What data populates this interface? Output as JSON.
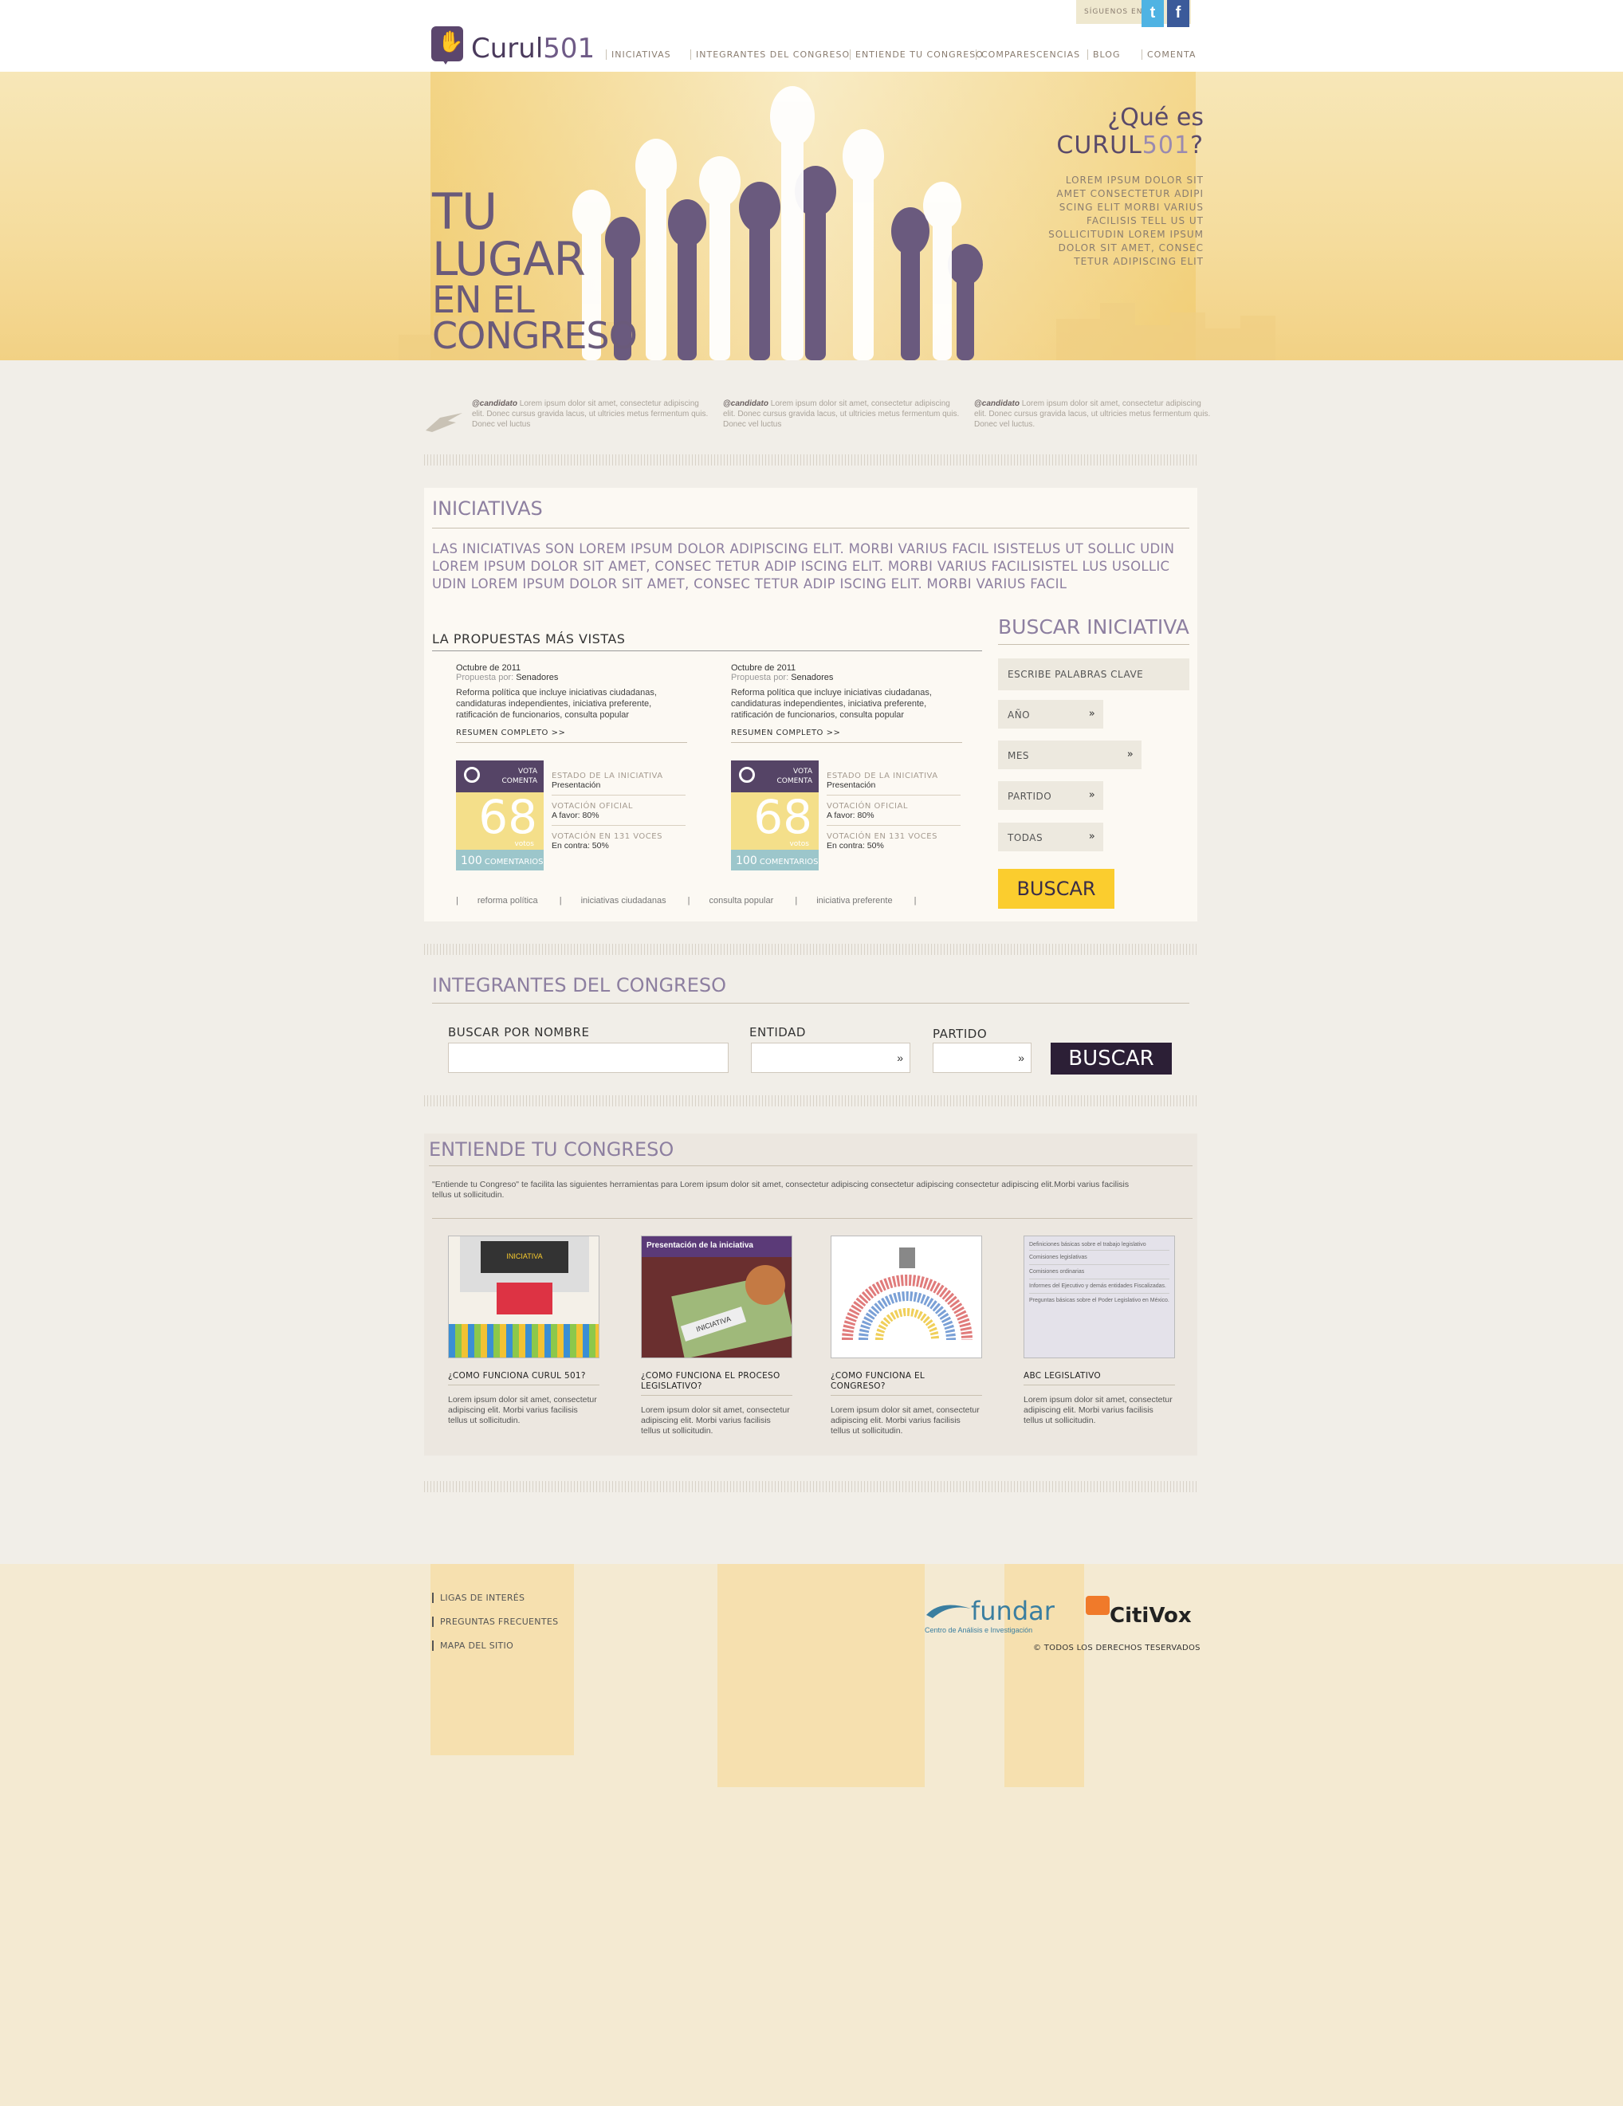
{
  "header": {
    "follow_label": "SÍGUENOS EN",
    "twitter_icon": "twitter-icon",
    "facebook_icon": "facebook-icon",
    "logo_text": "Curul",
    "logo_num": "501",
    "nav": [
      "INICIATIVAS",
      "INTEGRANTES DEL CONGRESO",
      "ENTIENDE TU CONGRESO",
      "COMPARESCENCIAS",
      "BLOG",
      "COMENTA"
    ]
  },
  "hero": {
    "title_lines": [
      "TU",
      "LUGAR",
      "EN EL",
      "CONGRESO"
    ],
    "que_line1": "¿Qué es",
    "que_line2_a": "CURUL",
    "que_line2_b": "501",
    "que_line2_c": "?",
    "description": "LOREM IPSUM DOLOR SIT AMET CONSECTETUR ADIPI SCING ELIT MORBI VARIUS FACILISIS TELL US UT SOLLICITUDIN LOREM IPSUM DOLOR SIT AMET, CONSEC TETUR ADIPISCING ELIT"
  },
  "tweets": [
    {
      "user": "@candidato",
      "text": "Lorem ipsum dolor sit amet, consectetur adipiscing elit. Donec cursus gravida lacus, ut ultricies metus fermentum quis. Donec vel luctus"
    },
    {
      "user": "@candidato",
      "text": "Lorem ipsum dolor sit amet, consectetur adipiscing elit. Donec cursus gravida lacus, ut ultricies metus fermentum quis. Donec vel luctus"
    },
    {
      "user": "@candidato",
      "text": "Lorem ipsum dolor sit amet, consectetur adipiscing elit. Donec cursus gravida lacus, ut ultricies metus fermentum quis. Donec vel luctus."
    }
  ],
  "iniciativas": {
    "title": "INICIATIVAS",
    "intro": "LAS INICIATIVAS SON LOREM IPSUM DOLOR ADIPISCING ELIT. MORBI VARIUS FACIL ISISTELUS UT SOLLIC UDIN LOREM IPSUM DOLOR SIT AMET, CONSEC TETUR ADIP ISCING ELIT. MORBI  VARIUS FACILISISTEL LUS USOLLIC UDIN LOREM IPSUM DOLOR SIT AMET, CONSEC TETUR ADIP ISCING ELIT. MORBI  VARIUS FACIL",
    "subtitle": "LA PROPUESTAS MÁS VISTAS",
    "cards": [
      {
        "date": "Octubre de 2011",
        "by_label": "Propuesta por:",
        "by": "Senadores",
        "body": "Reforma política que incluye iniciativas ciudadanas, candidaturas independientes, iniciativa preferente, ratificación de funcionarios, consulta popular",
        "more": "RESUMEN COMPLETO >>",
        "vote_line1": "VOTA",
        "vote_line2": "COMENTA",
        "votes": "68",
        "votes_label": "votos",
        "comments_num": "100",
        "comments_label": "COMENTARIOS",
        "estado_label": "ESTADO DE LA INICIATIVA",
        "estado": "Presentación",
        "oficial_label": "VOTACIÓN OFICIAL",
        "oficial": "A favor: 80%",
        "voces_label": "VOTACIÓN EN 131 VOCES",
        "voces": "En contra: 50%"
      },
      {
        "date": "Octubre de 2011",
        "by_label": "Propuesta por:",
        "by": "Senadores",
        "body": "Reforma política que incluye iniciativas ciudadanas, candidaturas independientes, iniciativa preferente, ratificación de funcionarios, consulta popular",
        "more": "RESUMEN COMPLETO >>",
        "vote_line1": "VOTA",
        "vote_line2": "COMENTA",
        "votes": "68",
        "votes_label": "votos",
        "comments_num": "100",
        "comments_label": "COMENTARIOS",
        "estado_label": "ESTADO DE LA INICIATIVA",
        "estado": "Presentación",
        "oficial_label": "VOTACIÓN OFICIAL",
        "oficial": "A favor: 80%",
        "voces_label": "VOTACIÓN EN 131 VOCES",
        "voces": "En contra: 50%"
      }
    ],
    "tags": [
      "reforma política",
      "iniciativas ciudadanas",
      "consulta popular",
      "iniciativa preferente"
    ],
    "search": {
      "title": "BUSCAR INICIATIVA",
      "keywords": "ESCRIBE PALABRAS CLAVE",
      "year": "AÑO",
      "month": "MES",
      "party": "PARTIDO",
      "all": "TODAS",
      "button": "BUSCAR"
    }
  },
  "integrantes": {
    "title": "INTEGRANTES DEL CONGRESO",
    "by_name_label": "BUSCAR POR NOMBRE",
    "entity_label": "ENTIDAD",
    "party_label": "PARTIDO",
    "button": "BUSCAR"
  },
  "entiende": {
    "title": "ENTIENDE TU CONGRESO",
    "intro": "\"Entiende tu Congreso\" te facilita las siguientes herramientas para Lorem ipsum dolor sit amet,  consectetur adipiscing  consectetur adipiscing  consectetur adipiscing elit.Morbi varius facilisis tellus ut sollicitudin.",
    "tools": [
      {
        "title": "¿COMO FUNCIONA CURUL 501?",
        "text": "Lorem ipsum dolor sit amet, consectetur adipiscing elit. Morbi varius facilisis tellus ut sollicitudin.",
        "thumb_label": "INICIATIVA"
      },
      {
        "title": "¿COMO FUNCIONA EL PROCESO LEGISLATIVO?",
        "text": "Lorem ipsum dolor sit amet, consectetur adipiscing elit. Morbi varius facilisis tellus ut sollicitudin.",
        "thumb_label": "Presentación de la iniciativa",
        "thumb_label2": "INICIATIVA"
      },
      {
        "title": "¿COMO FUNCIONA EL CONGRESO?",
        "text": "Lorem ipsum dolor sit amet, consectetur adipiscing elit. Morbi varius facilisis tellus ut sollicitudin."
      },
      {
        "title": "ABC LEGISLATIVO",
        "text": "Lorem ipsum dolor sit amet, consectetur adipiscing elit. Morbi varius facilisis tellus ut sollicitudin.",
        "list": [
          "Definiciones básicas sobre el trabajo legislativo",
          "Comisiones legislativas",
          "Comisiones ordinarias",
          "Informes del Ejecutivo y demás entidades Fiscalizadas.",
          "Preguntas básicas sobre el Poder Legislativo en México."
        ]
      }
    ]
  },
  "footer": {
    "links": [
      "LIGAS DE INTERÉS",
      "PREGUNTAS FRECUENTES",
      "MAPA DEL SITIO"
    ],
    "fundar": "fundar",
    "fundar_sub": "Centro de Análisis e Investigación",
    "citivox": "CitiVox",
    "rights": "© TODOS LOS DERECHOS TESERVADOS"
  },
  "colors": {
    "purple": "#5b466d",
    "yellow": "#fbcd2e",
    "dark": "#2c1f36",
    "teal": "#9cc6cb"
  }
}
